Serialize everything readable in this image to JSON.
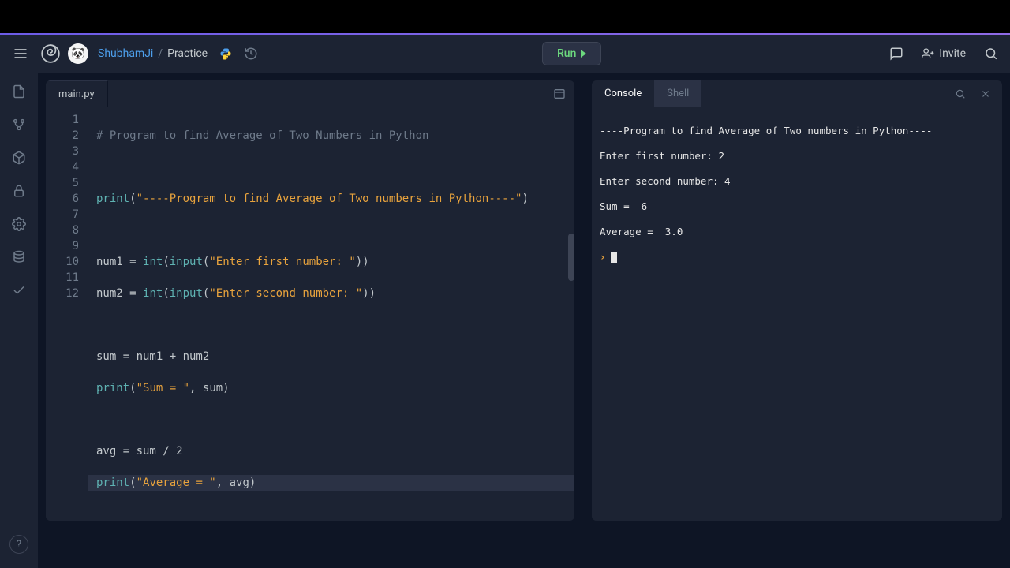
{
  "header": {
    "user": "ShubhamJi",
    "separator": "/",
    "project": "Practice",
    "run_label": "Run",
    "invite_label": "Invite",
    "avatar_emoji": "🐼"
  },
  "editor": {
    "tab_filename": "main.py",
    "line_numbers": [
      "1",
      "2",
      "3",
      "4",
      "5",
      "6",
      "7",
      "8",
      "9",
      "10",
      "11",
      "12"
    ],
    "lines": {
      "l1_comment": "# Program to find Average of Two Numbers in Python",
      "l3_print": "print",
      "l3_str": "\"----Program to find Average of Two numbers in Python----\"",
      "l5_var": "num1 ",
      "l5_eq": "= ",
      "l5_int": "int",
      "l5_input": "input",
      "l5_str": "\"Enter first number: \"",
      "l6_var": "num2 ",
      "l6_int": "int",
      "l6_input": "input",
      "l6_str": "\"Enter second number: \"",
      "l8": "sum = num1 + num2",
      "l9_print": "print",
      "l9_str": "\"Sum = \"",
      "l9_tail": ", sum)",
      "l11": "avg = sum / 2",
      "l12_print": "print",
      "l12_str": "\"Average = \"",
      "l12_tail": ", avg)"
    }
  },
  "console": {
    "tab_console": "Console",
    "tab_shell": "Shell",
    "out1": "----Program to find Average of Two numbers in Python----",
    "out2": "Enter first number: 2",
    "out3": "Enter second number: 4",
    "out4": "Sum =  6",
    "out5": "Average =  3.0",
    "prompt": "›"
  },
  "help": "?"
}
